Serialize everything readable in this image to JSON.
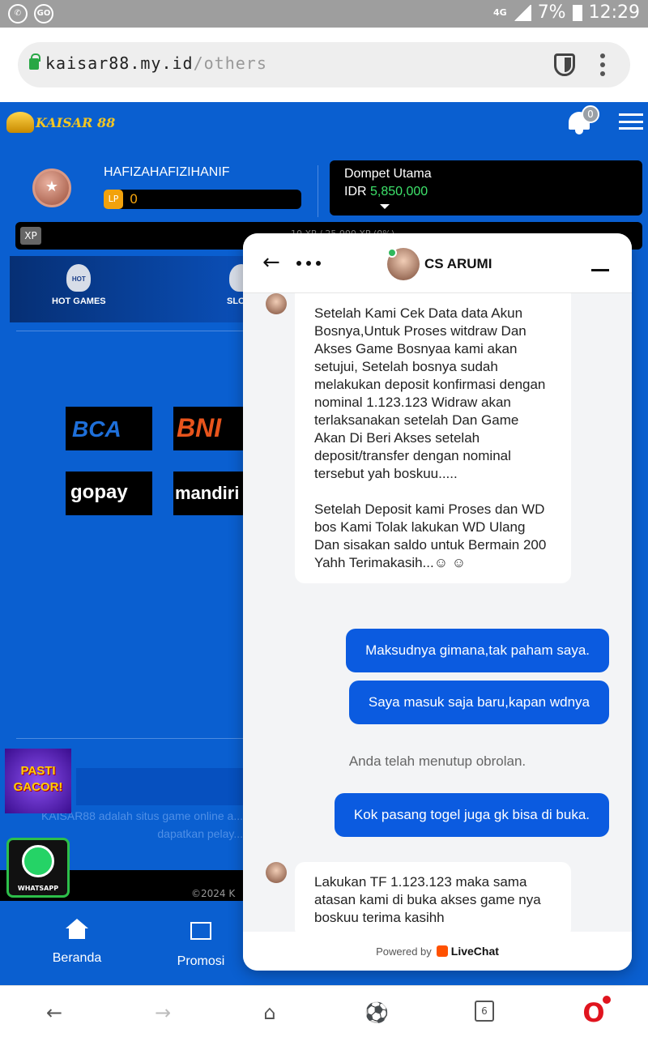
{
  "statusbar": {
    "network": "4G",
    "battery": "7%",
    "time": "12:29"
  },
  "browser": {
    "url_host": "kaisar88.my.id",
    "url_path": "/others"
  },
  "site": {
    "logo_text": "KAISAR 88",
    "notification_count": "0",
    "username": "HAFIZAHAFIZIHANIF",
    "lp_label": "LP",
    "lp_value": "0",
    "wallet_title": "Dompet Utama",
    "wallet_currency": "IDR",
    "wallet_amount": "5,850,000",
    "xp_label": "XP",
    "xp_progress_text": "10 XP / 25,000 XP (0%)",
    "categories": [
      {
        "label": "HOT GAMES",
        "icon": "hot-flame-icon"
      },
      {
        "label": "SLOTS",
        "icon": "cherry-icon"
      }
    ],
    "banks": [
      "BCA",
      "BNI",
      "gopay",
      "mandiri"
    ],
    "promo_badge": "PASTI GACOR!",
    "whatsapp_label": "WHATSAPP",
    "footer_text": "KAISAR88 adalah situs game online a... dapatkan pelay...",
    "copyright": "©2024 K",
    "bottom_nav": [
      {
        "label": "Beranda",
        "icon": "home-icon"
      },
      {
        "label": "Promosi",
        "icon": "gift-icon"
      }
    ]
  },
  "chat": {
    "agent_name": "CS ARUMI",
    "messages": [
      {
        "from": "agent",
        "text": "Setelah Kami Cek Data data Akun Bosnya,Untuk Proses witdraw Dan Akses Game Bosnyaa kami akan setujui, Setelah bosnya sudah melakukan deposit konfirmasi dengan nominal 1.123.123 Widraw akan terlaksanakan setelah Dan Game Akan Di Beri Akses setelah deposit/transfer dengan nominal tersebut yah boskuu....."
      },
      {
        "from": "agent",
        "text": "Setelah Deposit kami Proses dan WD bos Kami Tolak lakukan WD Ulang Dan sisakan saldo untuk Bermain 200 Yahh Terimakasih...☺ ☺"
      },
      {
        "from": "user",
        "text": "Maksudnya gimana,tak paham saya."
      },
      {
        "from": "user",
        "text": "Saya masuk saja baru,kapan wdnya"
      },
      {
        "from": "system",
        "text": "Anda telah menutup obrolan."
      },
      {
        "from": "user",
        "text": "Kok pasang togel juga gk bisa di buka."
      },
      {
        "from": "agent",
        "text": "Lakukan TF 1.123.123 maka sama atasan kami di buka akses game nya boskuu terima kasihh"
      }
    ],
    "powered_by": "Powered by",
    "provider": "LiveChat"
  },
  "browser_nav": {
    "tab_count": "6"
  },
  "colors": {
    "site_blue": "#0a5fd0",
    "chat_user_bubble": "#0b5be0",
    "wallet_amount": "#3ee36b",
    "lp_orange": "#f2a20c"
  }
}
